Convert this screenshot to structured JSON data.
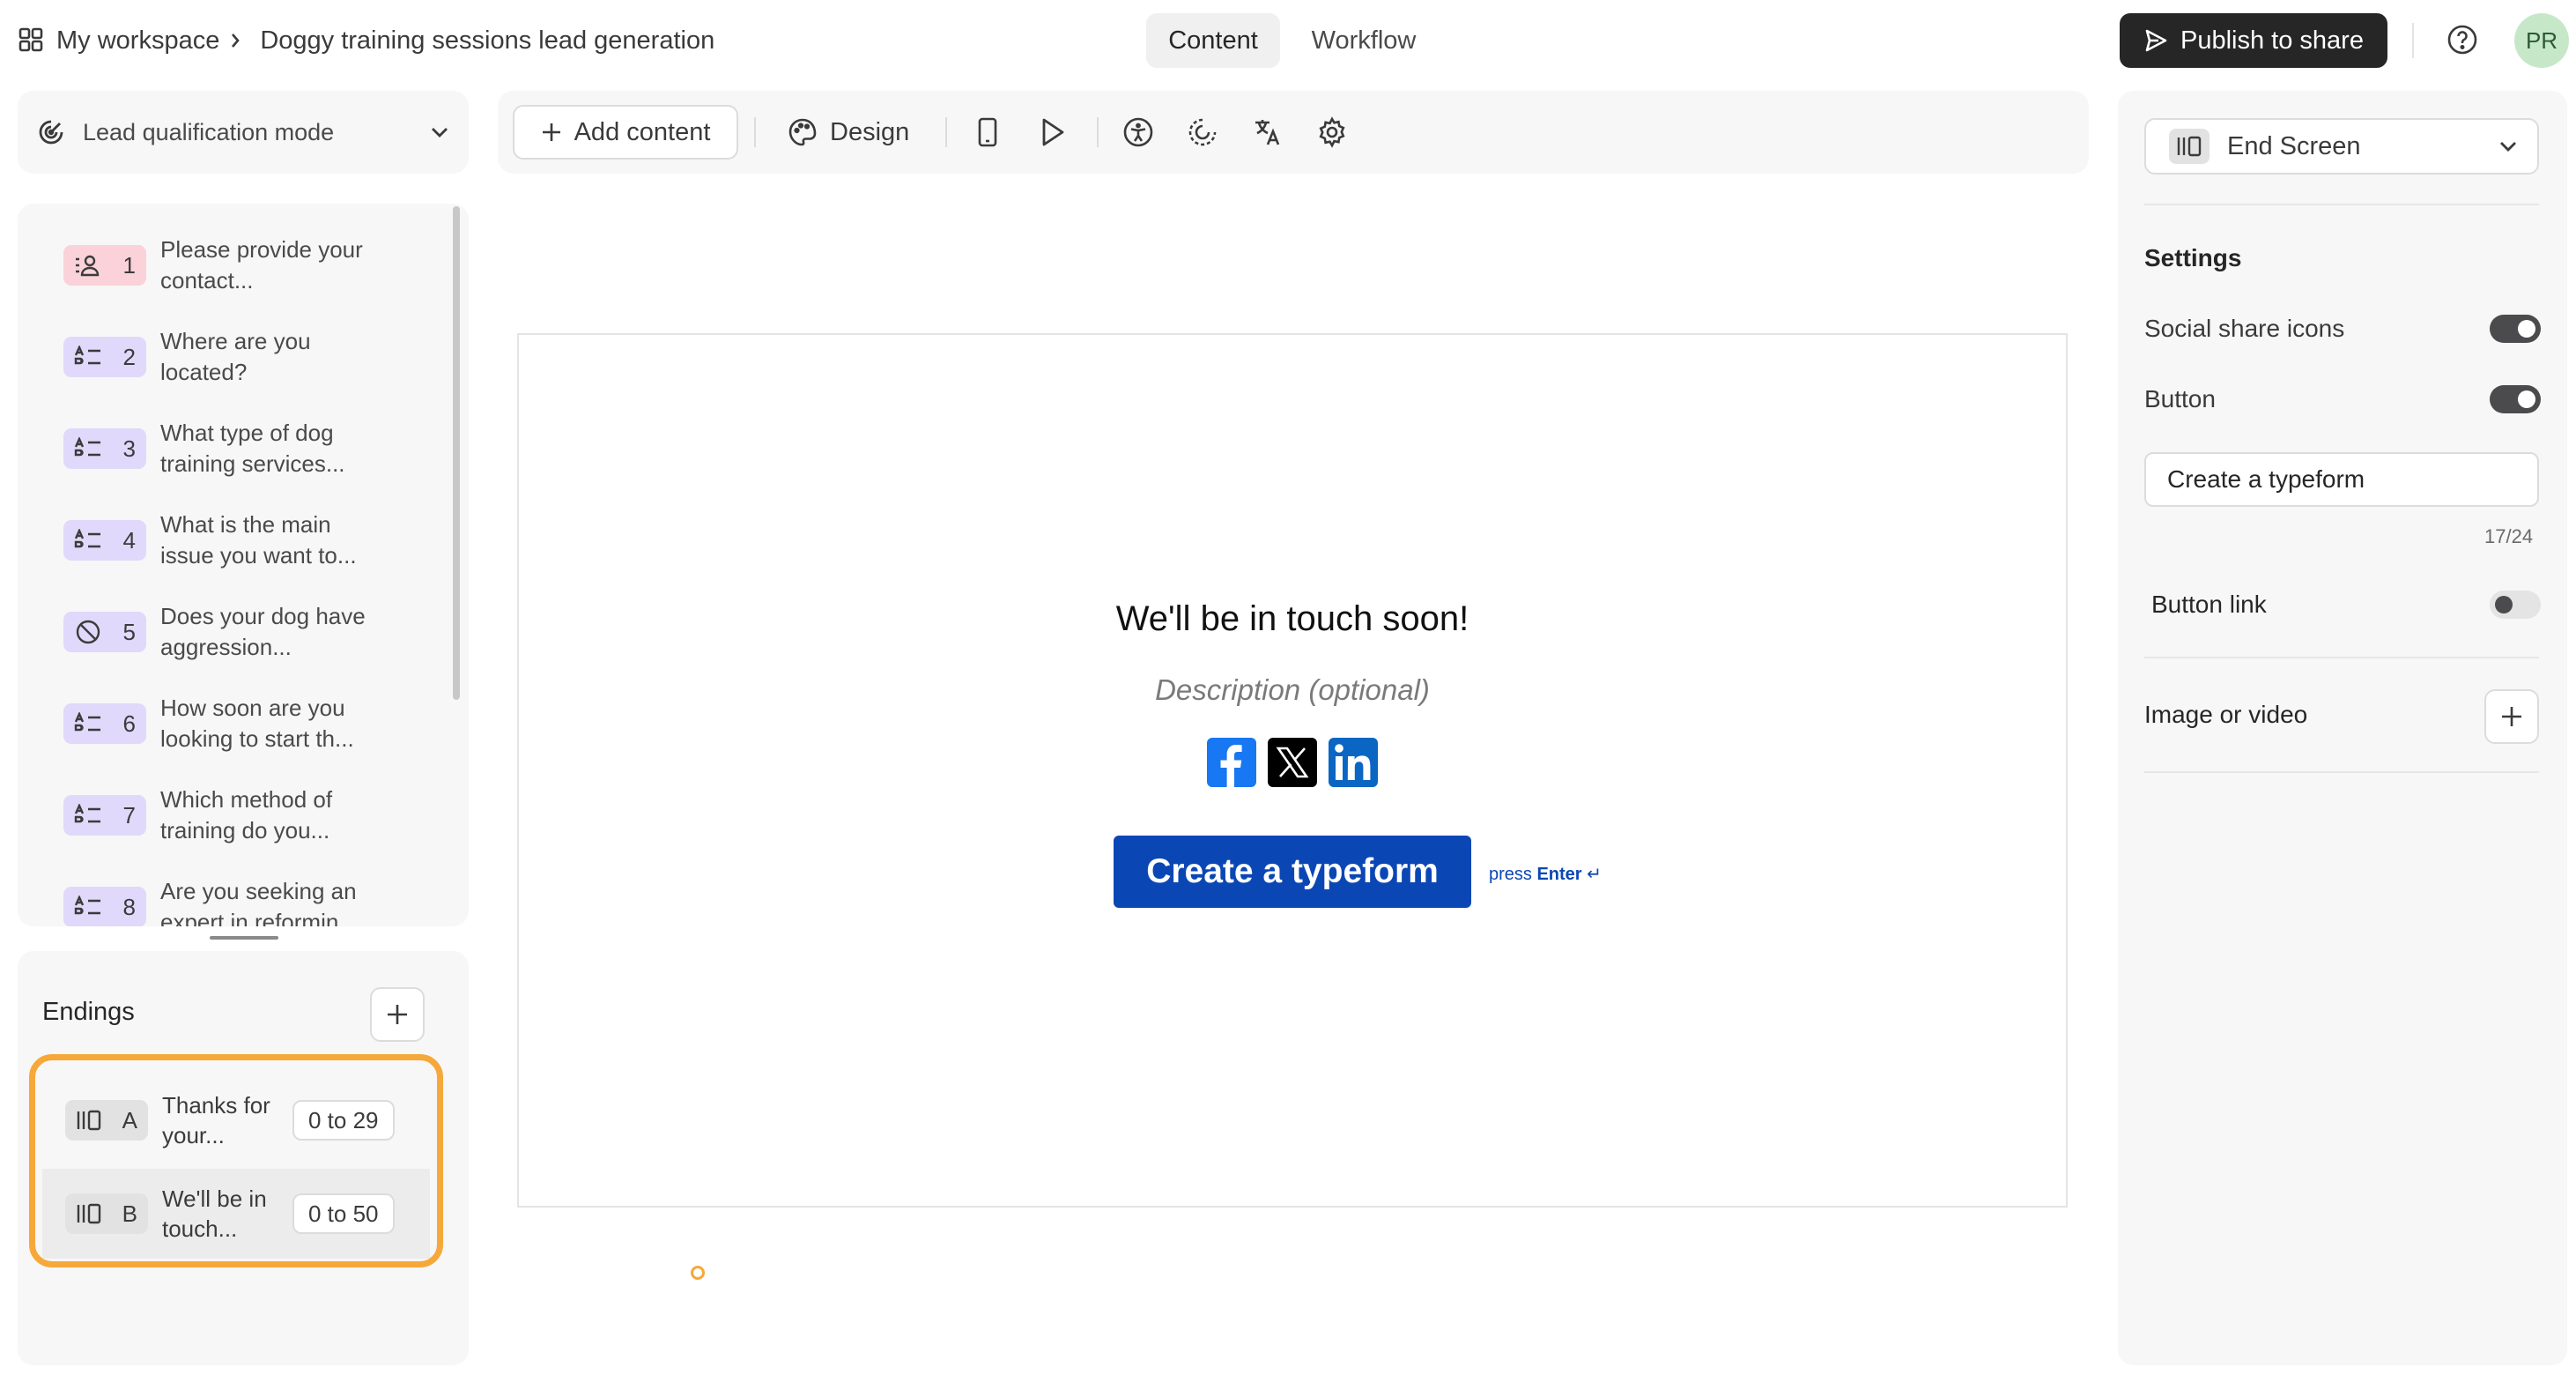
{
  "header": {
    "workspace": "My workspace",
    "form_title": "Doggy training sessions lead generation",
    "tabs": [
      {
        "label": "Content",
        "active": true
      },
      {
        "label": "Workflow",
        "active": false
      }
    ],
    "publish_label": "Publish to share",
    "avatar_initials": "PR"
  },
  "sidebar": {
    "mode_label": "Lead qualification mode",
    "questions": [
      {
        "number": "1",
        "text": "Please provide your contact...",
        "icon": "contact-icon",
        "color": "pink"
      },
      {
        "number": "2",
        "text": "Where are you located?",
        "icon": "multiple-choice-icon",
        "color": "purple"
      },
      {
        "number": "3",
        "text": "What type of dog training services...",
        "icon": "multiple-choice-icon",
        "color": "purple"
      },
      {
        "number": "4",
        "text": "What is the main issue you want to...",
        "icon": "multiple-choice-icon",
        "color": "purple"
      },
      {
        "number": "5",
        "text": "Does your dog have aggression...",
        "icon": "yes-no-icon",
        "color": "purple"
      },
      {
        "number": "6",
        "text": "How soon are you looking to start th...",
        "icon": "multiple-choice-icon",
        "color": "purple"
      },
      {
        "number": "7",
        "text": "Which method of training do you...",
        "icon": "multiple-choice-icon",
        "color": "purple"
      },
      {
        "number": "8",
        "text": "Are you seeking an expert in reformin",
        "icon": "multiple-choice-icon",
        "color": "purple"
      }
    ],
    "endings_title": "Endings",
    "endings": [
      {
        "letter": "A",
        "text": "Thanks for your...",
        "range": "0 to 29",
        "selected": false
      },
      {
        "letter": "B",
        "text": "We'll be in touch...",
        "range": "0 to 50",
        "selected": true
      }
    ]
  },
  "toolbar": {
    "add_content_label": "Add content",
    "design_label": "Design",
    "icons": [
      "mobile-preview-icon",
      "play-icon",
      "accessibility-icon",
      "logic-icon",
      "translate-icon",
      "settings-icon"
    ]
  },
  "canvas": {
    "title": "We'll be in touch soon!",
    "description_placeholder": "Description (optional)",
    "social": [
      "facebook-icon",
      "x-icon",
      "linkedin-icon"
    ],
    "button_label": "Create a typeform",
    "hint_prefix": "press",
    "hint_key": "Enter",
    "hint_symbol": "↵"
  },
  "settings_panel": {
    "screen_type": "End Screen",
    "settings_title": "Settings",
    "social_share_label": "Social share icons",
    "social_share_on": true,
    "button_label": "Button",
    "button_on": true,
    "button_text_value": "Create a typeform",
    "char_count": "17/24",
    "button_link_label": "Button link",
    "button_link_on": false,
    "image_video_label": "Image or video"
  },
  "colors": {
    "accent_button": "#0b47b4",
    "highlight": "#f6a83a",
    "dark": "#262627"
  }
}
